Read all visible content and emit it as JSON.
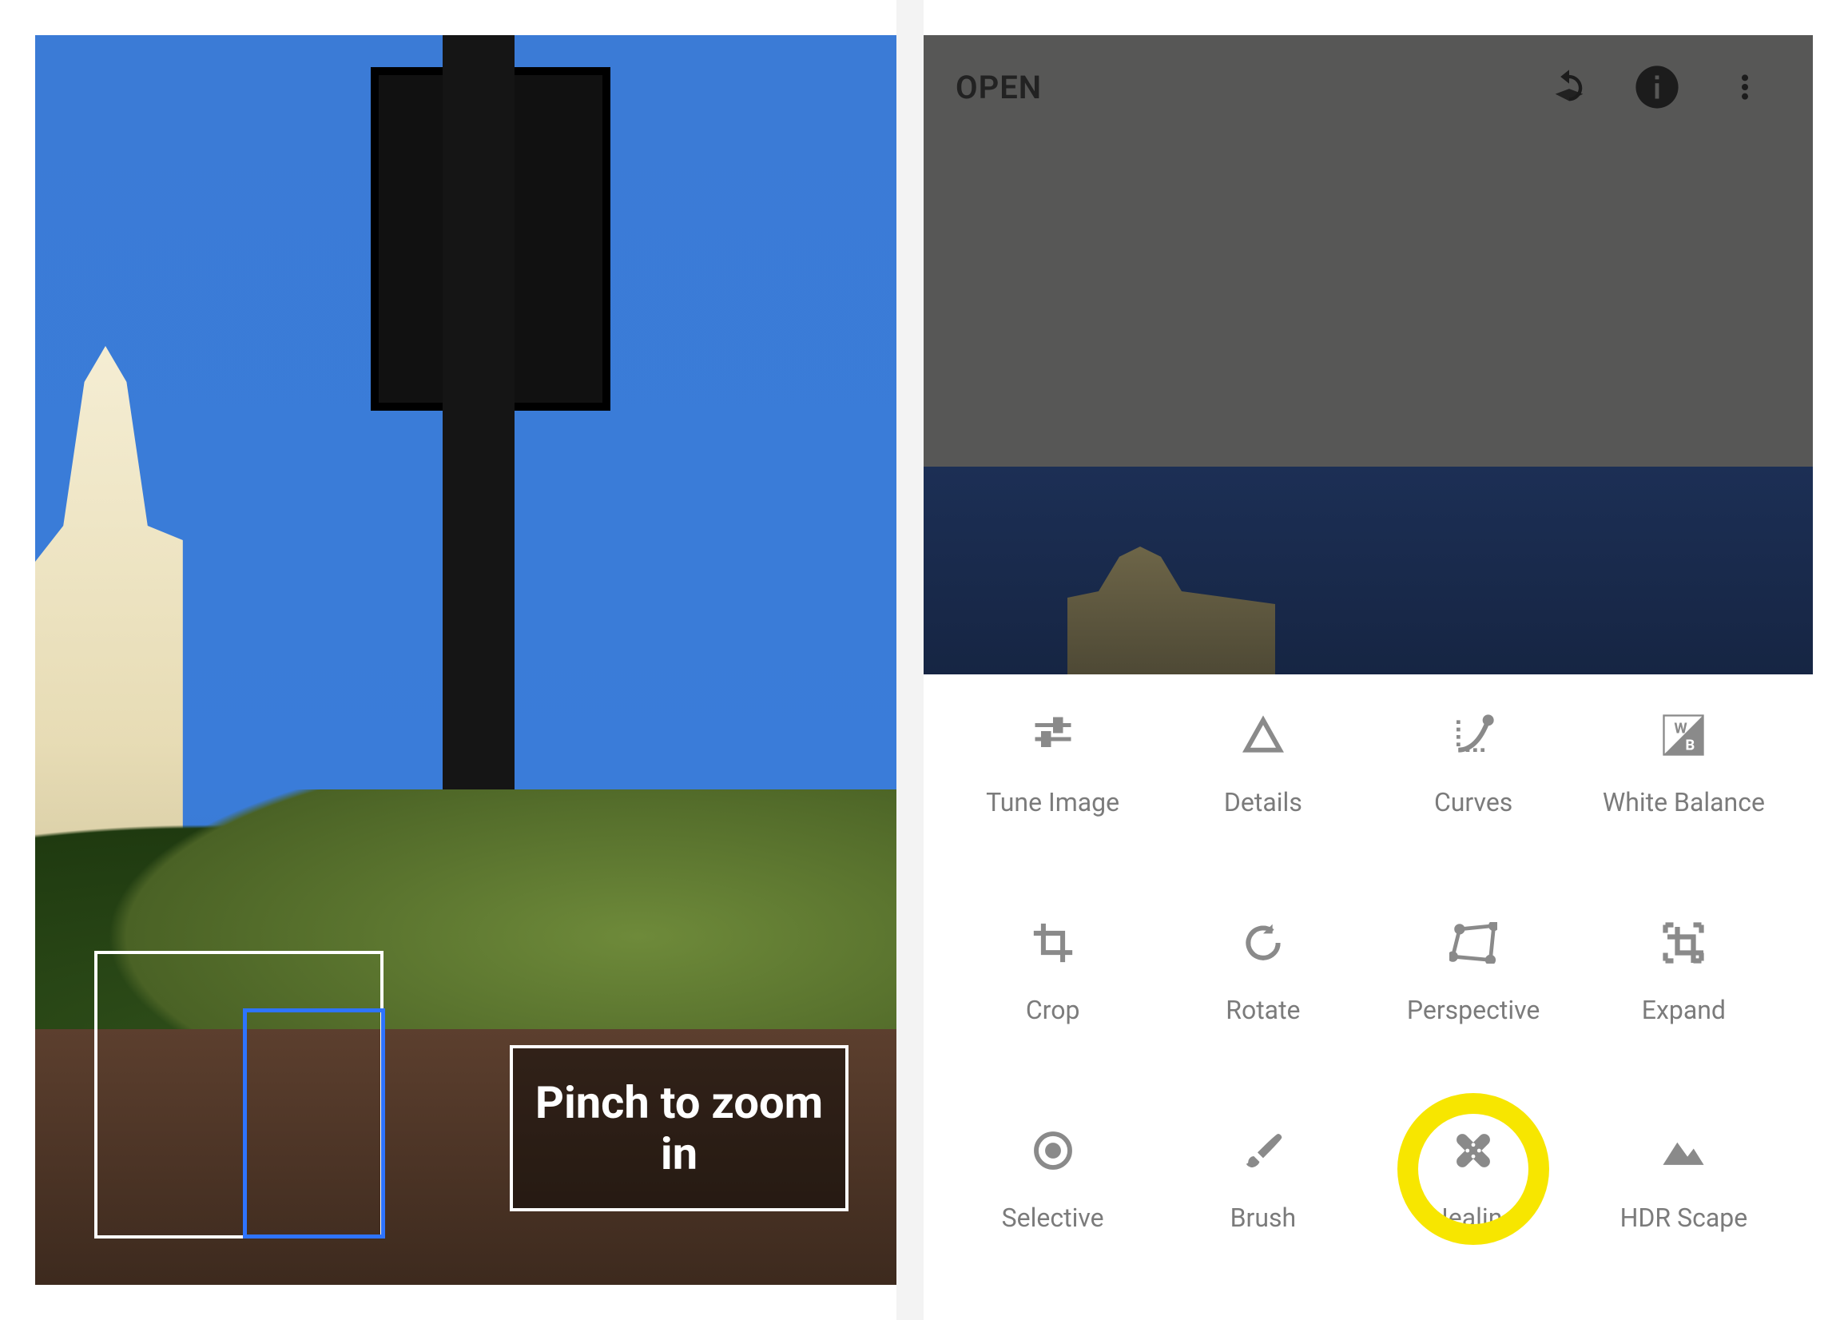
{
  "left": {
    "hint_text": "Pinch to zoom in"
  },
  "right": {
    "topbar": {
      "open_label": "OPEN"
    },
    "tools": [
      {
        "id": "tune-image",
        "label": "Tune Image",
        "icon": "tune-icon"
      },
      {
        "id": "details",
        "label": "Details",
        "icon": "details-icon"
      },
      {
        "id": "curves",
        "label": "Curves",
        "icon": "curves-icon"
      },
      {
        "id": "white-balance",
        "label": "White Balance",
        "icon": "white-balance-icon"
      },
      {
        "id": "crop",
        "label": "Crop",
        "icon": "crop-icon"
      },
      {
        "id": "rotate",
        "label": "Rotate",
        "icon": "rotate-icon"
      },
      {
        "id": "perspective",
        "label": "Perspective",
        "icon": "perspective-icon"
      },
      {
        "id": "expand",
        "label": "Expand",
        "icon": "expand-icon"
      },
      {
        "id": "selective",
        "label": "Selective",
        "icon": "selective-icon"
      },
      {
        "id": "brush",
        "label": "Brush",
        "icon": "brush-icon"
      },
      {
        "id": "healing",
        "label": "Healing",
        "icon": "healing-icon",
        "highlighted": true
      },
      {
        "id": "hdr-scape",
        "label": "HDR Scape",
        "icon": "hdr-scape-icon"
      }
    ]
  }
}
